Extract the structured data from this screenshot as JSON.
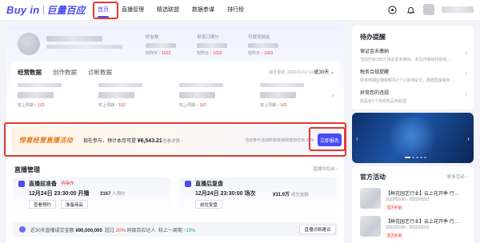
{
  "brand": {
    "name": "Buy in",
    "sub": "巨量百应"
  },
  "nav": {
    "items": [
      "首页",
      "直播管理",
      "精选联盟",
      "数据参谋",
      "排行榜"
    ],
    "active": 0
  },
  "header_stats": [
    {
      "label": "好友数",
      "compare_label": "较昨日",
      "change": "1622"
    },
    {
      "label": "带货口碑分",
      "compare_label": "较昨日",
      "change": "1622"
    },
    {
      "label": "可提现佣金",
      "compare_label": "较昨日",
      "change": "1622"
    }
  ],
  "overview": {
    "tabs": [
      "经营数据",
      "创作数据",
      "诊断数据"
    ],
    "active_tab": 0,
    "update_time": "最近更新: 2022/01/12 14:00",
    "range": "近30天",
    "metrics": [
      {
        "compare_label": "较上周期",
        "change": "162"
      },
      {
        "compare_label": "较上周期",
        "change": "162"
      },
      {
        "compare_label": "较上周期",
        "change": "162"
      },
      {
        "compare_label": "较上周期",
        "change": "162"
      }
    ]
  },
  "banner": {
    "title": "惊喜经营直播活动",
    "desc_prefix": "现在参与，预计本月可提",
    "amount": "¥6,543.21",
    "link": "查看详情 ›",
    "note": "活动参与活动所有效视频增加付出 32%",
    "button": "立即报名"
  },
  "live": {
    "title": "直播管理",
    "link": "直播中控台 ›",
    "cards": [
      {
        "title": "直播前准备",
        "tag": "待操作",
        "time": "12月24日 23:30:00 开播",
        "stat_value": "3167",
        "stat_label": "人预约",
        "buttons": [
          "查看预约",
          "准备商品"
        ]
      },
      {
        "title": "直播后复盘",
        "tag": "",
        "time": "12月24日 23:30:00 场次",
        "stat_value": "¥31.9万",
        "stat_label": "成交金额",
        "buttons": [
          "前往复盘"
        ]
      }
    ],
    "diag": {
      "prefix": "近30天直播成交金额",
      "amount": "¥90,000,000",
      "mid": "超过",
      "percent": "20%",
      "suffix": "同级百应达人",
      "rank_label": "较上一周期",
      "rank": "↑10%",
      "button": "直播诊断建议"
    }
  },
  "todo": {
    "title": "待办提醒",
    "items": [
      {
        "title": "保证金未缴纳",
        "desc": "当前仍有300元保证金未缴纳，未及时缴纳将影响…"
      },
      {
        "title": "税务合规提醒",
        "desc": "即将到期应缴税额共3个订单待提交，根据国家税务…"
      },
      {
        "title": "异常您的违规",
        "desc": "商品有5个违规商品待处理"
      }
    ]
  },
  "carousel": {
    "slides": 5,
    "active": 0
  },
  "activity": {
    "title": "官方活动",
    "more": "更多活动 ›",
    "items": [
      {
        "name": "【鲜花园艺行业】云上花开季 行…",
        "date": "2022/02/20 - 2022/02/22",
        "tag": "官方补贴"
      },
      {
        "name": "【鲜花园艺行业】云上花开季 行…",
        "date": "2022/02/20 - 2022/02/22",
        "tag": "官方补贴"
      }
    ]
  },
  "colors": {
    "accent": "#4a4bf5",
    "up": "#e8392f",
    "highlight_box": "#e8392f"
  }
}
